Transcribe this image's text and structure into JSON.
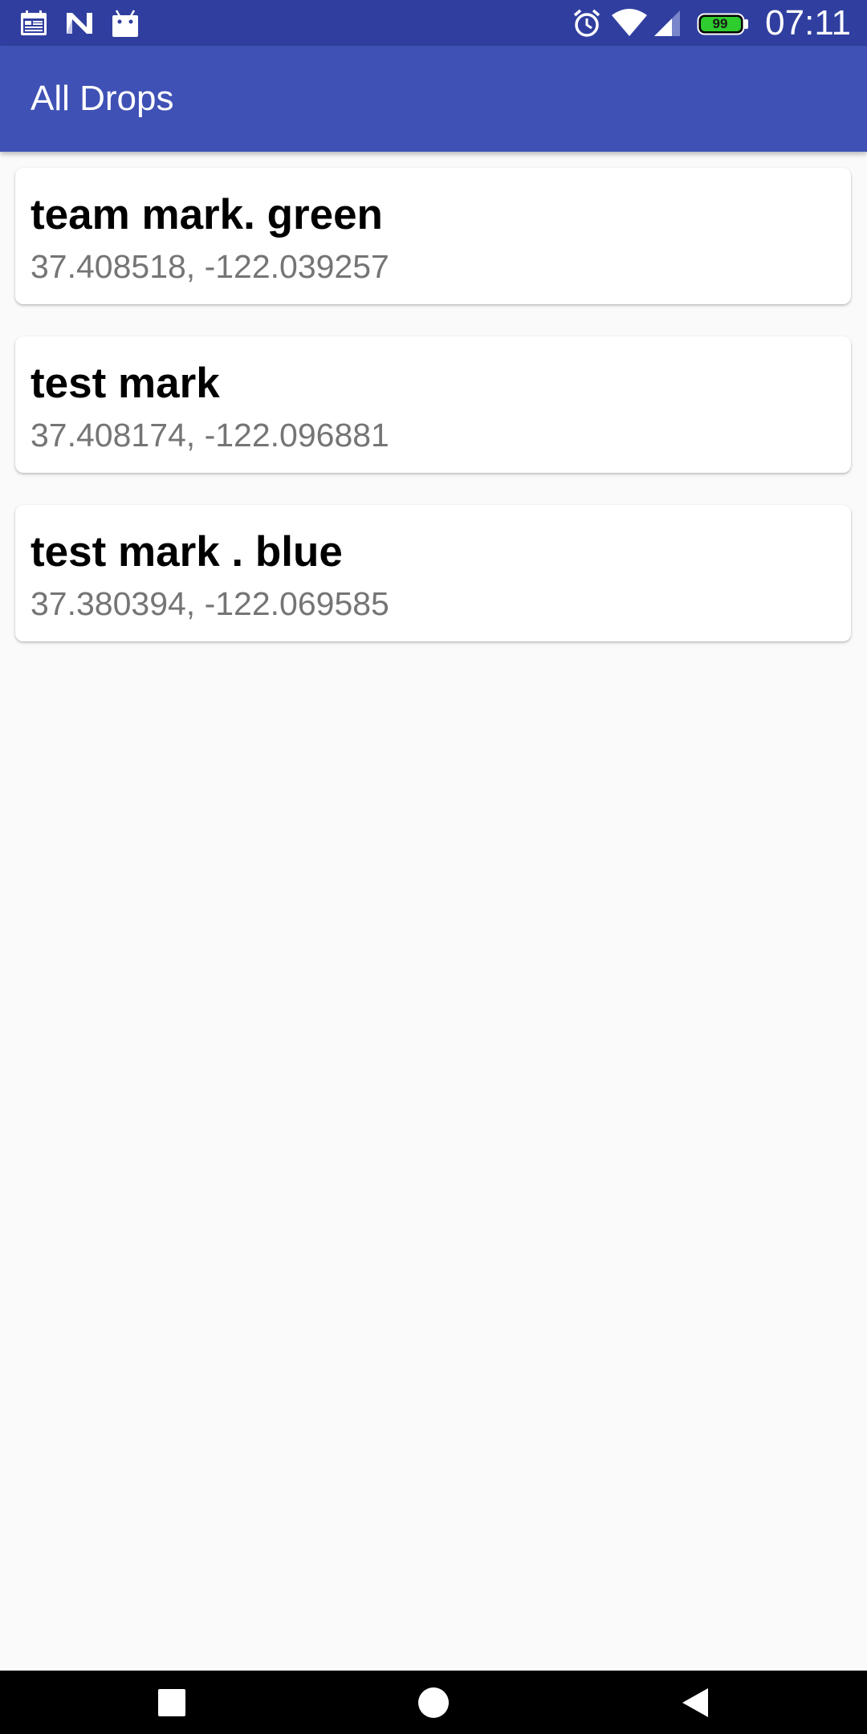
{
  "status_bar": {
    "time": "07:11",
    "battery_level": "99",
    "icons": [
      "calendar-icon",
      "n-notification-icon",
      "android-icon",
      "alarm-icon",
      "wifi-icon",
      "cell-signal-icon",
      "battery-icon"
    ]
  },
  "app_bar": {
    "title": "All Drops"
  },
  "drops": [
    {
      "name": "team mark. green",
      "coords": "37.408518, -122.039257"
    },
    {
      "name": "test mark",
      "coords": "37.408174, -122.096881"
    },
    {
      "name": "test mark . blue",
      "coords": "37.380394, -122.069585"
    }
  ],
  "nav_bar": {
    "icons": [
      "recents-square-icon",
      "home-circle-icon",
      "back-triangle-icon"
    ]
  },
  "colors": {
    "status_bar": "#303f9f",
    "app_bar": "#3f51b5",
    "background": "#fafafa",
    "card": "#ffffff",
    "secondary_text": "#757575",
    "battery_fill": "#2ecc2e"
  }
}
